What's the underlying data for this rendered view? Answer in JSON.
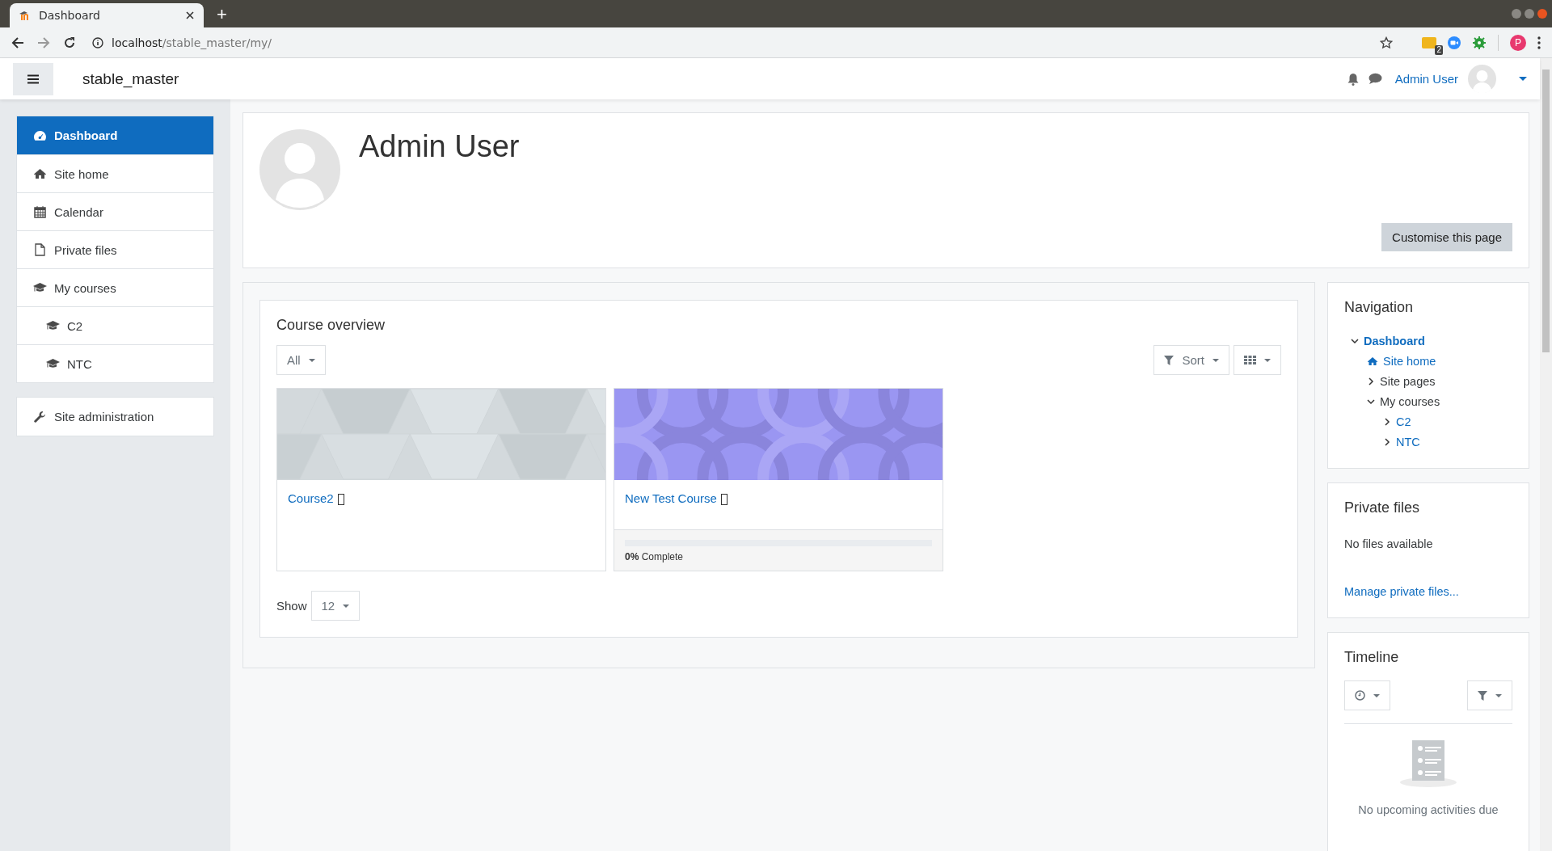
{
  "browser": {
    "tab": {
      "title": "Dashboard"
    },
    "new_tab": "+",
    "url_host": "localhost",
    "url_path": "/stable_master/my/",
    "extension_badge": "2",
    "profile_initial": "P"
  },
  "navbar": {
    "site_name": "stable_master",
    "user_name": "Admin User"
  },
  "sidebar": {
    "items": [
      {
        "label": "Dashboard",
        "selected": true
      },
      {
        "label": "Site home",
        "selected": false
      },
      {
        "label": "Calendar",
        "selected": false
      },
      {
        "label": "Private files",
        "selected": false
      },
      {
        "label": "My courses",
        "selected": false,
        "children": [
          {
            "label": "C2",
            "selected": false
          },
          {
            "label": "NTC",
            "selected": false
          }
        ]
      }
    ],
    "admin_items": [
      {
        "label": "Site administration",
        "selected": false
      }
    ]
  },
  "header": {
    "name": "Admin User",
    "button": "Customise this page"
  },
  "course_overview": {
    "title": "Course overview",
    "filter": "All",
    "sort": "Sort",
    "courses": [
      {
        "name": "Course2"
      },
      {
        "name": "New Test Course",
        "progress": {
          "text": "**0%** Complete",
          "level": 0
        }
      }
    ],
    "show_label": "Show",
    "per_page": "12"
  },
  "navigation": {
    "title": "Navigation",
    "tree": [
      {
        "label": "Dashboard",
        "kind": "current",
        "expanded": true,
        "children": [
          {
            "label": "Site home",
            "kind": "home"
          },
          {
            "label": "Site pages",
            "kind": "section",
            "expanded": false
          },
          {
            "label": "My courses",
            "kind": "section",
            "expanded": true,
            "children": [
              {
                "label": "C2",
                "kind": "course",
                "expanded": false
              },
              {
                "label": "NTC",
                "kind": "course",
                "expanded": false
              }
            ]
          }
        ]
      }
    ]
  },
  "private_files": {
    "title": "Private files",
    "message": "No files available",
    "link": "Manage private files..."
  },
  "timeline": {
    "title": "Timeline",
    "message": "No upcoming activities due"
  }
}
